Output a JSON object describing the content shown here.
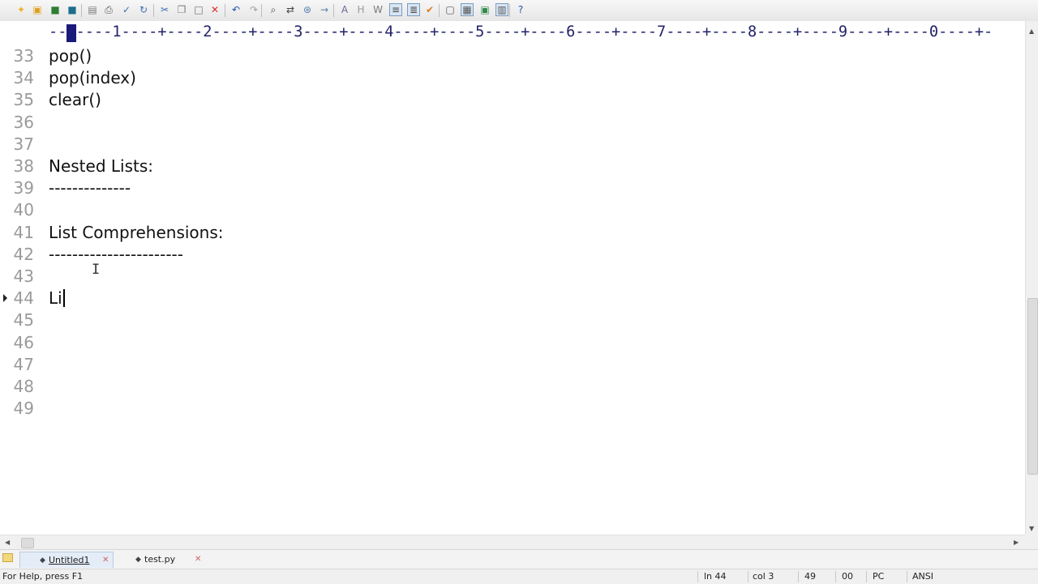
{
  "toolbar": {
    "buttons": [
      {
        "icon": "new-file-icon",
        "glyph": "✦",
        "color": "#f0b030"
      },
      {
        "icon": "open-folder-icon",
        "glyph": "▣",
        "color": "#e0a020"
      },
      {
        "icon": "save-icon",
        "glyph": "■",
        "color": "#2e7d32"
      },
      {
        "icon": "save-all-icon",
        "glyph": "■",
        "color": "#1b6e8a"
      },
      {
        "icon": "print-preview-icon",
        "glyph": "▤",
        "color": "#7a7a7a"
      },
      {
        "icon": "print-icon",
        "glyph": "⎙",
        "color": "#555555"
      },
      {
        "icon": "spell-check-icon",
        "glyph": "✓",
        "color": "#3c6fb0"
      },
      {
        "icon": "reload-icon",
        "glyph": "↻",
        "color": "#3c6fb0"
      },
      {
        "icon": "cut-icon",
        "glyph": "✂",
        "color": "#3c6fb0"
      },
      {
        "icon": "copy-icon",
        "glyph": "❐",
        "color": "#7a7a7a"
      },
      {
        "icon": "paste-icon",
        "glyph": "□",
        "color": "#6a6a6a"
      },
      {
        "icon": "delete-icon",
        "glyph": "✕",
        "color": "#d32f2f"
      },
      {
        "icon": "undo-icon",
        "glyph": "↶",
        "color": "#1e56b0"
      },
      {
        "icon": "redo-icon",
        "glyph": "↷",
        "color": "#a0a0a0"
      },
      {
        "icon": "find-icon",
        "glyph": "⌕",
        "color": "#444444"
      },
      {
        "icon": "replace-icon",
        "glyph": "⇄",
        "color": "#444444"
      },
      {
        "icon": "find-in-files-icon",
        "glyph": "⊛",
        "color": "#5a7fb0"
      },
      {
        "icon": "goto-icon",
        "glyph": "→",
        "color": "#5a7fb0"
      },
      {
        "icon": "font-icon",
        "glyph": "A",
        "color": "#6a6a9a"
      },
      {
        "icon": "hex-icon",
        "glyph": "H",
        "color": "#9a9a9a"
      },
      {
        "icon": "word-wrap-icon",
        "glyph": "W",
        "color": "#7a7a7a"
      },
      {
        "icon": "show-spaces-icon",
        "glyph": "≡",
        "color": "#444444",
        "pressed": true
      },
      {
        "icon": "show-line-numbers-icon",
        "glyph": "≣",
        "color": "#444444",
        "pressed": true
      },
      {
        "icon": "check-icon",
        "glyph": "✔",
        "color": "#e07a20"
      },
      {
        "icon": "window-icon",
        "glyph": "▢",
        "color": "#555555"
      },
      {
        "icon": "tile-icon",
        "glyph": "▦",
        "color": "#555555",
        "pressed": true
      },
      {
        "icon": "full-screen-icon",
        "glyph": "▣",
        "color": "#2e8a4a"
      },
      {
        "icon": "split-icon",
        "glyph": "▥",
        "color": "#555555",
        "pressed": true
      },
      {
        "icon": "help-icon",
        "glyph": "?",
        "color": "#1e56b0"
      }
    ]
  },
  "ruler": {
    "text": "--+----1----+----2----+----3----+----4----+----5----+----6----+----7----+----8----+----9----+----0----+-"
  },
  "editor": {
    "lines": [
      {
        "number": "33",
        "text": "pop()"
      },
      {
        "number": "34",
        "text": "pop(index)"
      },
      {
        "number": "35",
        "text": "clear()"
      },
      {
        "number": "36",
        "text": ""
      },
      {
        "number": "37",
        "text": ""
      },
      {
        "number": "38",
        "text": "Nested Lists:"
      },
      {
        "number": "39",
        "text": "--------------"
      },
      {
        "number": "40",
        "text": ""
      },
      {
        "number": "41",
        "text": "List Comprehensions:"
      },
      {
        "number": "42",
        "text": "-----------------------"
      },
      {
        "number": "43",
        "text": ""
      },
      {
        "number": "44",
        "text": "Li",
        "current": true
      },
      {
        "number": "45",
        "text": ""
      },
      {
        "number": "46",
        "text": ""
      },
      {
        "number": "47",
        "text": ""
      },
      {
        "number": "48",
        "text": ""
      },
      {
        "number": "49",
        "text": ""
      }
    ]
  },
  "tabs": [
    {
      "label": "Untitled1",
      "active": true
    },
    {
      "label": "test.py",
      "active": false
    }
  ],
  "status": {
    "help": "For Help, press F1",
    "line": "ln 44",
    "col": "col 3",
    "lines_total": "49",
    "code": "00",
    "line_ending": "PC",
    "encoding": "ANSI"
  }
}
